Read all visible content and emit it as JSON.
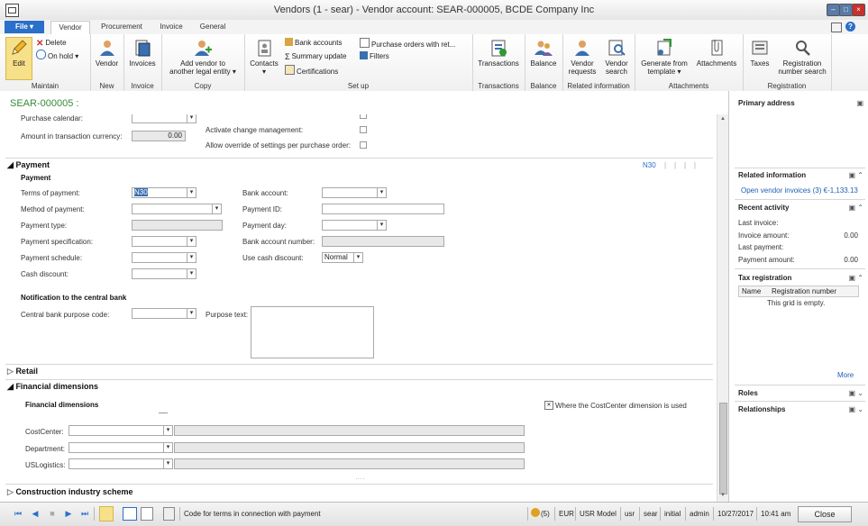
{
  "window": {
    "title": "Vendors (1 - sear) - Vendor account: SEAR-000005, BCDE Company Inc"
  },
  "tabs": [
    {
      "label": "File"
    },
    {
      "label": "Vendor"
    },
    {
      "label": "Procurement"
    },
    {
      "label": "Invoice"
    },
    {
      "label": "General"
    }
  ],
  "ribbon": {
    "maintain": {
      "label": "Maintain",
      "edit": "Edit",
      "delete": "Delete",
      "on_hold": "On hold"
    },
    "new": {
      "label": "New",
      "vendor": "Vendor"
    },
    "invoice": {
      "label": "Invoice",
      "invoices": "Invoices"
    },
    "copy": {
      "label": "Copy",
      "add_vendor_1": "Add vendor to",
      "add_vendor_2": "another legal entity"
    },
    "setup": {
      "label": "Set up",
      "contacts": "Contacts",
      "bank_accounts": "Bank accounts",
      "summary_update": "Summary update",
      "certifications": "Certifications",
      "purchase_orders": "Purchase orders with ret...",
      "filters": "Filters"
    },
    "transactions": {
      "label": "Transactions",
      "transactions": "Transactions"
    },
    "balance": {
      "label": "Balance",
      "balance": "Balance"
    },
    "related": {
      "label": "Related information",
      "vendor_requests_1": "Vendor",
      "vendor_requests_2": "requests",
      "vendor_search_1": "Vendor",
      "vendor_search_2": "search"
    },
    "attachments": {
      "label": "Attachments",
      "generate_1": "Generate from",
      "generate_2": "template",
      "attachments": "Attachments"
    },
    "registration": {
      "label": "Registration",
      "taxes": "Taxes",
      "regsearch_1": "Registration",
      "regsearch_2": "number search"
    }
  },
  "record": {
    "id": "SEAR-000005 :"
  },
  "top_section": {
    "purchase_calendar": "Purchase calendar:",
    "amount_label": "Amount in transaction currency:",
    "amount_value": "0.00",
    "activate_change": "Activate change management:",
    "allow_override": "Allow override of settings per purchase order:"
  },
  "payment": {
    "section_title": "Payment",
    "summary": "N30",
    "subheader": "Payment",
    "terms_label": "Terms of payment:",
    "terms_value": "N30",
    "method_label": "Method of payment:",
    "type_label": "Payment type:",
    "spec_label": "Payment specification:",
    "schedule_label": "Payment schedule:",
    "cash_discount_label": "Cash discount:",
    "bank_account_label": "Bank account:",
    "payment_id_label": "Payment ID:",
    "payment_day_label": "Payment day:",
    "bank_account_number_label": "Bank account number:",
    "use_cash_discount_label": "Use cash discount:",
    "use_cash_discount_value": "Normal",
    "notification_header": "Notification to the central bank",
    "central_bank_label": "Central bank purpose code:",
    "purpose_text_label": "Purpose text:"
  },
  "retail": {
    "section_title": "Retail"
  },
  "financial": {
    "section_title": "Financial dimensions",
    "subheader": "Financial dimensions",
    "where_used": "Where the CostCenter dimension is used",
    "costcenter_label": "CostCenter:",
    "department_label": "Department:",
    "uslogistics_label": "USLogistics:"
  },
  "construction": {
    "section_title": "Construction industry scheme"
  },
  "rightpane": {
    "primary_address": "Primary address",
    "related_information": "Related information",
    "open_invoices": "Open vendor invoices (3) €-1,133.13",
    "recent_activity": "Recent activity",
    "last_invoice": "Last invoice:",
    "invoice_amount": "Invoice amount:",
    "invoice_amount_value": "0.00",
    "last_payment": "Last payment:",
    "payment_amount": "Payment amount:",
    "payment_amount_value": "0.00",
    "tax_registration": "Tax registration",
    "col_name": "Name",
    "col_regnum": "Registration number",
    "grid_empty": "This grid is empty.",
    "more": "More",
    "roles": "Roles",
    "relationships": "Relationships"
  },
  "statusbar": {
    "help_text": "Code for terms in connection with payment",
    "count": "(5)",
    "currency": "EUR",
    "model": "USR Model",
    "layer": "usr",
    "company": "sear",
    "partition": "initial",
    "user": "admin",
    "date": "10/27/2017",
    "time": "10:41 am",
    "close": "Close"
  },
  "colors": {
    "accent": "#2a6fc9",
    "record_id": "#3a8a3a",
    "link": "#1f5fb5"
  }
}
